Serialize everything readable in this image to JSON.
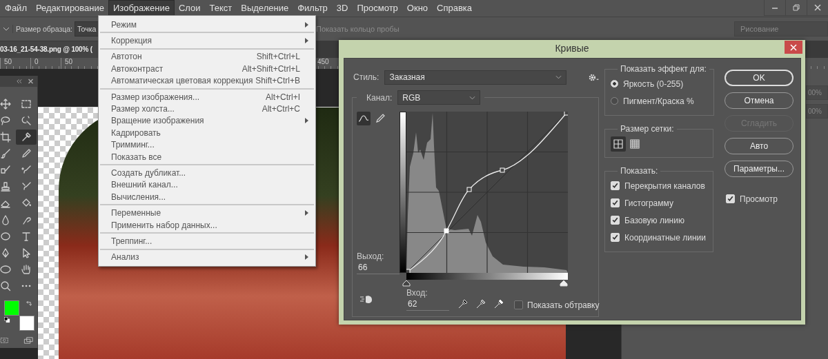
{
  "menu_bar": {
    "items": [
      {
        "label": "Файл",
        "selected": false
      },
      {
        "label": "Редактирование",
        "selected": false
      },
      {
        "label": "Изображение",
        "selected": true
      },
      {
        "label": "Слои",
        "selected": false
      },
      {
        "label": "Текст",
        "selected": false
      },
      {
        "label": "Выделение",
        "selected": false
      },
      {
        "label": "Фильтр",
        "selected": false
      },
      {
        "label": "3D",
        "selected": false
      },
      {
        "label": "Просмотр",
        "selected": false
      },
      {
        "label": "Окно",
        "selected": false
      },
      {
        "label": "Справка",
        "selected": false
      }
    ]
  },
  "options_bar": {
    "sample_size_label": "Размер образца:",
    "sample_size_value": "Точка",
    "show_ring_label": "Показать кольцо пробы",
    "mode_value": "Рисование"
  },
  "document_tab": {
    "title": "03-16_21-54-38.png @ 100% ("
  },
  "ruler": {
    "labels": [
      "50",
      "0",
      "50",
      "450"
    ]
  },
  "toolbox": {
    "tools": [
      {
        "kind": "move",
        "selected": false
      },
      {
        "kind": "marquee",
        "selected": false
      },
      {
        "kind": "lasso",
        "selected": false
      },
      {
        "kind": "quick-select",
        "selected": false
      },
      {
        "kind": "crop",
        "selected": false
      },
      {
        "kind": "eyedropper",
        "selected": true
      },
      {
        "kind": "brush",
        "selected": false
      },
      {
        "kind": "pencil",
        "selected": false
      },
      {
        "kind": "healing",
        "selected": false
      },
      {
        "kind": "mixer-brush",
        "selected": false
      },
      {
        "kind": "stamp",
        "selected": false
      },
      {
        "kind": "history-brush",
        "selected": false
      },
      {
        "kind": "eraser",
        "selected": false
      },
      {
        "kind": "bucket",
        "selected": false
      },
      {
        "kind": "blur",
        "selected": false
      },
      {
        "kind": "smudge",
        "selected": false
      },
      {
        "kind": "sponge",
        "selected": false
      },
      {
        "kind": "type",
        "selected": false
      },
      {
        "kind": "pen",
        "selected": false
      },
      {
        "kind": "path-select",
        "selected": false
      },
      {
        "kind": "ellipse",
        "selected": false
      },
      {
        "kind": "hand",
        "selected": false
      },
      {
        "kind": "zoom",
        "selected": false
      },
      {
        "kind": "more",
        "selected": false
      }
    ],
    "swatches": [
      {
        "color": "#00ff00"
      },
      {
        "color": "#ffffff"
      }
    ]
  },
  "image_menu": {
    "sections": [
      [
        {
          "label": "Режим",
          "submenu": true
        }
      ],
      [
        {
          "label": "Коррекция",
          "submenu": true
        }
      ],
      [
        {
          "label": "Автотон",
          "shortcut": "Shift+Ctrl+L",
          "submenu": false
        },
        {
          "label": "Автоконтраст",
          "shortcut": "Alt+Shift+Ctrl+L",
          "submenu": false
        },
        {
          "label": "Автоматическая цветовая коррекция",
          "shortcut": "Shift+Ctrl+B",
          "submenu": false
        }
      ],
      [
        {
          "label": "Размер изображения...",
          "shortcut": "Alt+Ctrl+I",
          "submenu": false
        },
        {
          "label": "Размер холста...",
          "shortcut": "Alt+Ctrl+C",
          "submenu": false
        },
        {
          "label": "Вращение изображения",
          "submenu": true
        },
        {
          "label": "Кадрировать",
          "submenu": false
        },
        {
          "label": "Тримминг...",
          "submenu": false
        },
        {
          "label": "Показать все",
          "submenu": false
        }
      ],
      [
        {
          "label": "Создать дубликат...",
          "submenu": false
        },
        {
          "label": "Внешний канал...",
          "submenu": false
        },
        {
          "label": "Вычисления...",
          "submenu": false
        }
      ],
      [
        {
          "label": "Переменные",
          "submenu": true
        },
        {
          "label": "Применить набор данных...",
          "submenu": false
        }
      ],
      [
        {
          "label": "Треппинг...",
          "submenu": false
        }
      ],
      [
        {
          "label": "Анализ",
          "submenu": true
        }
      ]
    ]
  },
  "curves_dialog": {
    "title": "Кривые",
    "style_label": "Стиль:",
    "style_value": "Заказная",
    "channel_label": "Канал:",
    "channel_value": "RGB",
    "curve_tools": [
      {
        "kind": "curve",
        "selected": true
      },
      {
        "kind": "pencil",
        "selected": false
      }
    ],
    "output_label": "Выход:",
    "output_value": "66",
    "input_label": "Вход:",
    "input_value": "62",
    "show_clipping": {
      "label": "Показать обтравку",
      "checked": false
    },
    "show_effect": {
      "title": "Показать эффект для:",
      "options": [
        {
          "label": "Яркость (0-255)",
          "selected": true
        },
        {
          "label": "Пигмент/Краска %",
          "selected": false
        }
      ]
    },
    "grid_size": {
      "title": "Размер сетки:",
      "options": [
        {
          "kind": "coarse",
          "selected": true
        },
        {
          "kind": "fine",
          "selected": false
        }
      ]
    },
    "show": {
      "title": "Показать:",
      "options": [
        {
          "label": "Перекрытия каналов",
          "checked": true
        },
        {
          "label": "Гистограмму",
          "checked": true
        },
        {
          "label": "Базовую линию",
          "checked": true
        },
        {
          "label": "Координатные линии",
          "checked": true
        }
      ]
    },
    "buttons": [
      {
        "label": "OK",
        "primary": true,
        "disabled": false
      },
      {
        "label": "Отмена",
        "primary": false,
        "disabled": false
      },
      {
        "label": "Сгладить",
        "primary": false,
        "disabled": true
      },
      {
        "label": "Авто",
        "primary": false,
        "disabled": false
      },
      {
        "label": "Параметры...",
        "primary": false,
        "disabled": false
      }
    ],
    "preview": {
      "label": "Просмотр",
      "checked": true
    }
  },
  "right_panel": {
    "fields": [
      "00%",
      "00%"
    ]
  }
}
